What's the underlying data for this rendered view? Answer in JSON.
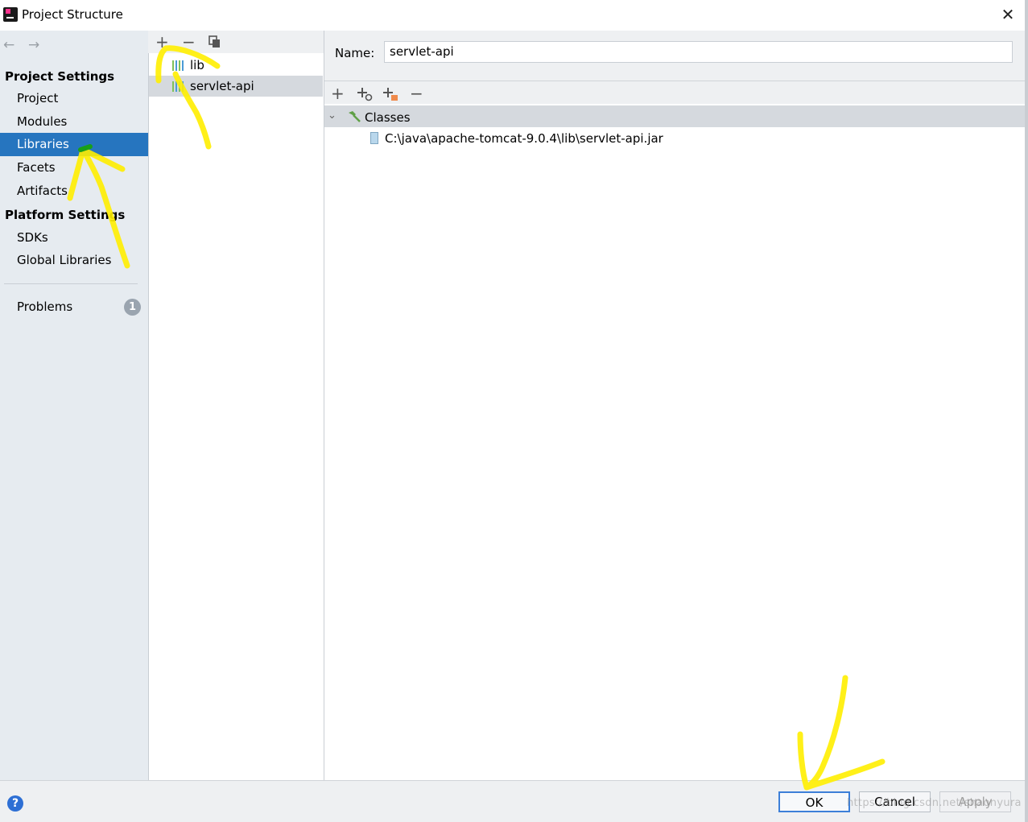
{
  "window": {
    "title": "Project Structure",
    "close_glyph": "✕"
  },
  "nav": {
    "back": "←",
    "forward": "→"
  },
  "sidebar": {
    "project_settings_header": "Project Settings",
    "project_items": [
      {
        "label": "Project",
        "selected": false
      },
      {
        "label": "Modules",
        "selected": false
      },
      {
        "label": "Libraries",
        "selected": true
      },
      {
        "label": "Facets",
        "selected": false
      },
      {
        "label": "Artifacts",
        "selected": false
      }
    ],
    "platform_settings_header": "Platform Settings",
    "platform_items": [
      {
        "label": "SDKs"
      },
      {
        "label": "Global Libraries"
      }
    ],
    "problems": {
      "label": "Problems",
      "count": "1"
    }
  },
  "libraries_toolbar": {
    "add_glyph": "+",
    "remove_glyph": "−",
    "copy_icon": "copy-icon"
  },
  "libraries": [
    {
      "name": "lib",
      "selected": false
    },
    {
      "name": "servlet-api",
      "selected": true
    }
  ],
  "detail": {
    "name_label": "Name:",
    "name_value": "servlet-api",
    "toolbar": {
      "add_glyph": "+",
      "add_icon": "add-icon",
      "add_url_icon": "add-jar-url-icon",
      "add_native_icon": "add-native-icon",
      "remove_glyph": "−"
    },
    "tree": {
      "expand_glyph": "⌄",
      "root_label": "Classes",
      "root_icon": "hammer-icon",
      "entries": [
        {
          "path": "C:\\java\\apache-tomcat-9.0.4\\lib\\servlet-api.jar",
          "icon": "jar-icon"
        }
      ]
    }
  },
  "footer": {
    "help_glyph": "?",
    "ok_label": "OK",
    "cancel_label": "Cancel",
    "apply_label": "Apply",
    "watermark": "https://blog.csdn.net/shaonyura"
  },
  "colors": {
    "selection_blue": "#2675bf",
    "sidebar_bg": "#e6ebf0",
    "annotation_yellow": "#ffee00",
    "library_icon_green": "#7fc159",
    "library_icon_blue": "#4a9bd6"
  }
}
